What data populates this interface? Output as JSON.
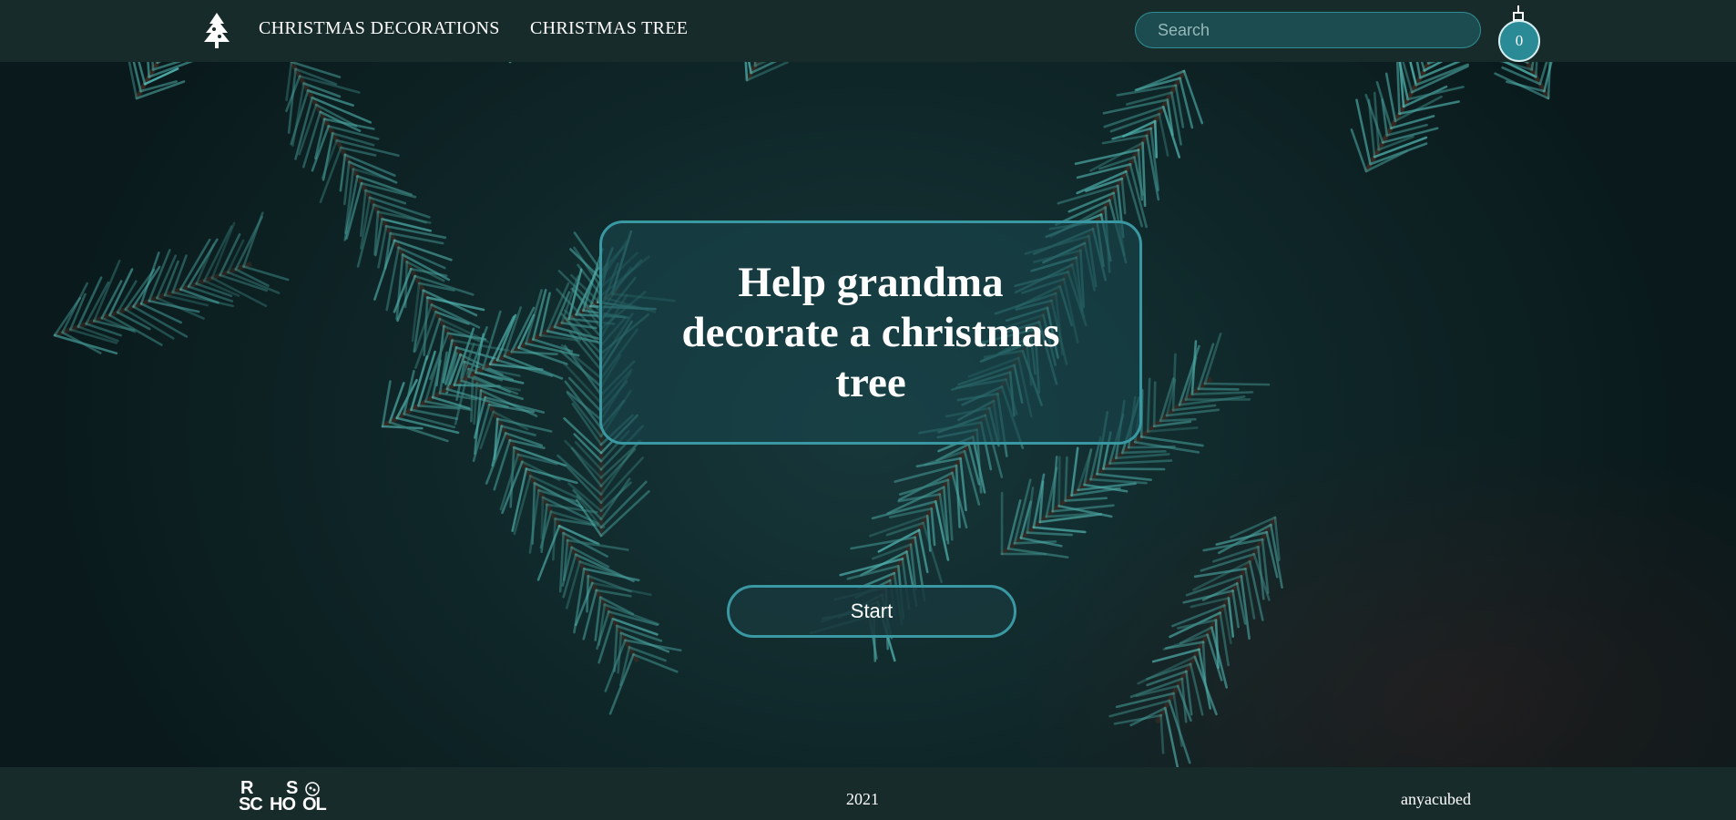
{
  "header": {
    "logo_icon": "christmas-tree-icon",
    "nav": [
      {
        "label": "CHRISTMAS DECORATIONS"
      },
      {
        "label": "CHRISTMAS TREE"
      }
    ],
    "search": {
      "placeholder": "Search",
      "value": ""
    },
    "favorites_count": "0",
    "favorites_icon": "ornament-ball-icon"
  },
  "hero": {
    "title": "Help grandma decorate a christmas tree",
    "start_label": "Start",
    "background": "pine-branches-photo"
  },
  "footer": {
    "logo_letters": [
      "R",
      "S",
      "SC",
      "HO",
      "OL"
    ],
    "year": "2021",
    "author": "anyacubed"
  },
  "colors": {
    "header_bg": "#182b2b",
    "accent": "#3a98a3",
    "counter_bg": "#2a8a95",
    "text": "#ffffff"
  }
}
